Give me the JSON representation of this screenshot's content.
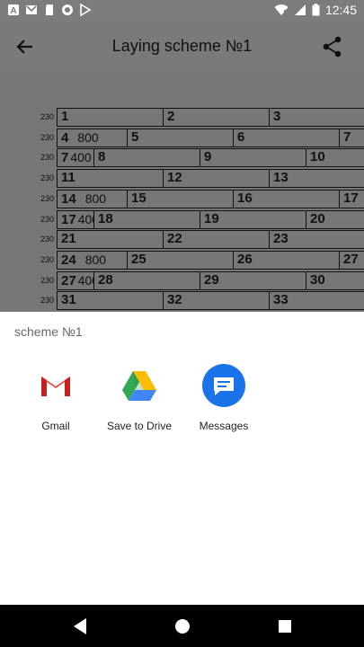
{
  "status_bar": {
    "time": "12:45"
  },
  "app_bar": {
    "title": "Laying scheme №1"
  },
  "scheme": {
    "rows": [
      {
        "label": "230",
        "cells": [
          {
            "n": "1"
          },
          {
            "n": "2"
          },
          {
            "n": "3"
          }
        ]
      },
      {
        "label": "230",
        "cells": [
          {
            "n": "4",
            "sub": "800"
          },
          {
            "n": "5"
          },
          {
            "n": "6"
          },
          {
            "n": "7"
          }
        ]
      },
      {
        "label": "230",
        "cells": [
          {
            "n": "7",
            "sub": "400",
            "small": true
          },
          {
            "n": "8"
          },
          {
            "n": "9"
          },
          {
            "n": "10"
          }
        ]
      },
      {
        "label": "230",
        "cells": [
          {
            "n": "11"
          },
          {
            "n": "12"
          },
          {
            "n": "13"
          }
        ]
      },
      {
        "label": "230",
        "cells": [
          {
            "n": "14",
            "sub": "800"
          },
          {
            "n": "15"
          },
          {
            "n": "16"
          },
          {
            "n": "17"
          }
        ]
      },
      {
        "label": "230",
        "cells": [
          {
            "n": "17",
            "sub": "400",
            "small": true
          },
          {
            "n": "18"
          },
          {
            "n": "19"
          },
          {
            "n": "20"
          }
        ]
      },
      {
        "label": "230",
        "cells": [
          {
            "n": "21"
          },
          {
            "n": "22"
          },
          {
            "n": "23"
          }
        ]
      },
      {
        "label": "230",
        "cells": [
          {
            "n": "24",
            "sub": "800"
          },
          {
            "n": "25"
          },
          {
            "n": "26"
          },
          {
            "n": "27"
          }
        ]
      },
      {
        "label": "230",
        "cells": [
          {
            "n": "27",
            "sub": "400",
            "small": true
          },
          {
            "n": "28"
          },
          {
            "n": "29"
          },
          {
            "n": "30"
          }
        ]
      },
      {
        "label": "230",
        "cells": [
          {
            "n": "31"
          },
          {
            "n": "32"
          },
          {
            "n": "33"
          }
        ]
      }
    ]
  },
  "share_sheet": {
    "title": "scheme №1",
    "targets": [
      {
        "label": "Gmail",
        "icon": "gmail-icon"
      },
      {
        "label": "Save to Drive",
        "icon": "google-drive-icon"
      },
      {
        "label": "Messages",
        "icon": "messages-icon"
      }
    ]
  },
  "colors": {
    "scrim": "#7a7a7a",
    "sheet_bg": "#ffffff",
    "messages_blue": "#1a73e8",
    "nav_bg": "#000000"
  }
}
